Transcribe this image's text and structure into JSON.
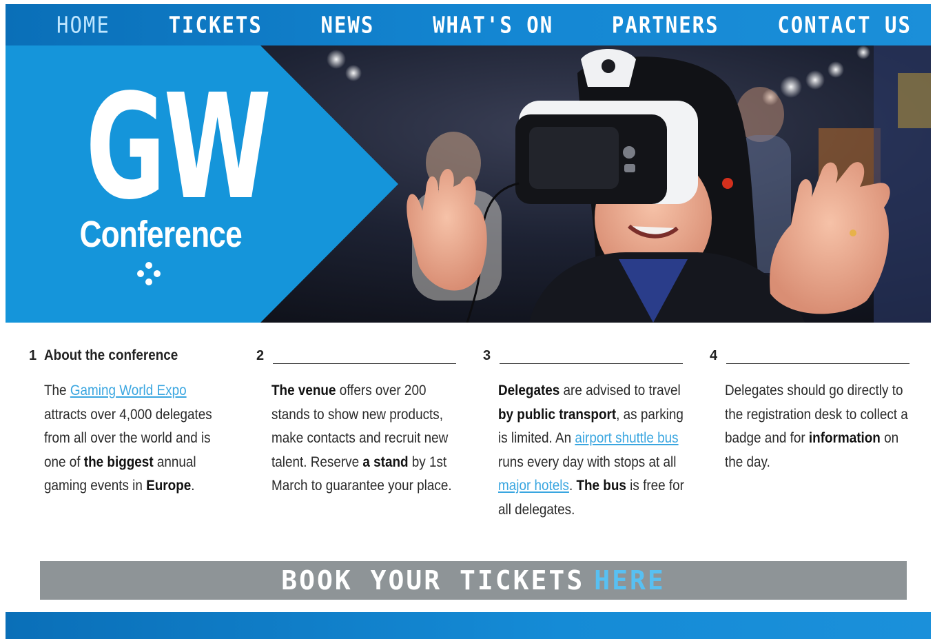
{
  "nav": {
    "items": [
      "HOME",
      "TICKETS",
      "NEWS",
      "WHAT'S ON",
      "PARTNERS",
      "CONTACT US"
    ]
  },
  "hero": {
    "logo_main": "GW",
    "logo_sub": "Conference",
    "accent_color": "#1595da"
  },
  "columns": [
    {
      "number": "1",
      "title": "About the conference",
      "segments": [
        {
          "t": "The ",
          "s": "n"
        },
        {
          "t": "Gaming World Expo",
          "s": "l"
        },
        {
          "t": " attracts over 4,000 delegates from all over the world and is one of ",
          "s": "n"
        },
        {
          "t": "the biggest",
          "s": "b"
        },
        {
          "t": " annual gaming events in ",
          "s": "n"
        },
        {
          "t": "Europe",
          "s": "b"
        },
        {
          "t": ".",
          "s": "n"
        }
      ]
    },
    {
      "number": "2",
      "title": "",
      "segments": [
        {
          "t": "The venue",
          "s": "b"
        },
        {
          "t": " offers over 200 stands to show new products, make contacts and recruit new talent. Reserve ",
          "s": "n"
        },
        {
          "t": "a stand",
          "s": "b"
        },
        {
          "t": " by 1st March to guarantee your place.",
          "s": "n"
        }
      ]
    },
    {
      "number": "3",
      "title": "",
      "segments": [
        {
          "t": "Delegates",
          "s": "b"
        },
        {
          "t": " are advised to travel ",
          "s": "n"
        },
        {
          "t": "by public transport",
          "s": "b"
        },
        {
          "t": ", as parking is limited. An ",
          "s": "n"
        },
        {
          "t": "airport shuttle bus",
          "s": "l"
        },
        {
          "t": " runs every day with stops at all ",
          "s": "n"
        },
        {
          "t": "major hotels",
          "s": "l"
        },
        {
          "t": ". ",
          "s": "n"
        },
        {
          "t": "The bus",
          "s": "b"
        },
        {
          "t": " is free for all delegates.",
          "s": "n"
        }
      ]
    },
    {
      "number": "4",
      "title": "",
      "segments": [
        {
          "t": "Delegates should go directly to the registration desk to collect a badge and for ",
          "s": "n"
        },
        {
          "t": "information",
          "s": "b"
        },
        {
          "t": " on the day.",
          "s": "n"
        }
      ]
    }
  ],
  "banner": {
    "main": "BOOK YOUR TICKETS",
    "highlight": "HERE",
    "bg_color": "#8e9497",
    "highlight_color": "#58c0f2"
  },
  "colors": {
    "nav": "#0a6fb8",
    "link": "#3aa6e0"
  }
}
